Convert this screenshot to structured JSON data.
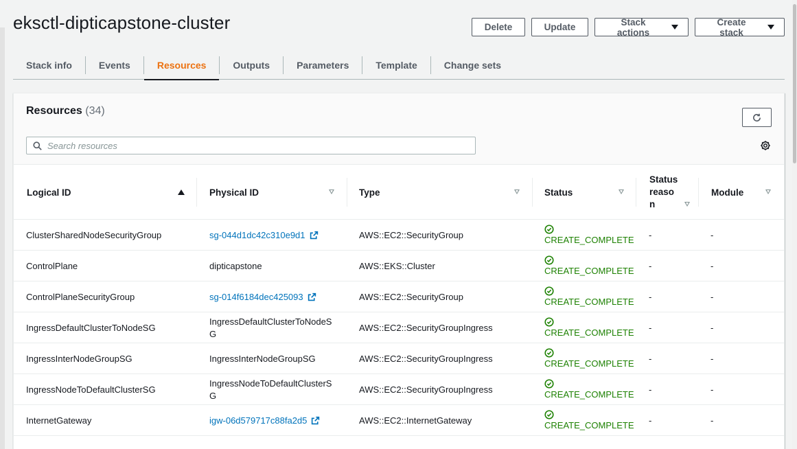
{
  "page": {
    "title": "eksctl-dipticapstone-cluster"
  },
  "header_actions": {
    "delete_label": "Delete",
    "update_label": "Update",
    "stack_actions_label": "Stack actions",
    "create_stack_label": "Create stack"
  },
  "tabs": [
    {
      "label": "Stack info"
    },
    {
      "label": "Events"
    },
    {
      "label": "Resources",
      "active": true
    },
    {
      "label": "Outputs"
    },
    {
      "label": "Parameters"
    },
    {
      "label": "Template"
    },
    {
      "label": "Change sets"
    }
  ],
  "resources": {
    "title": "Resources",
    "count": "(34)",
    "search_placeholder": "Search resources",
    "columns": {
      "logical_id": "Logical ID",
      "physical_id": "Physical ID",
      "type": "Type",
      "status": "Status",
      "status_reason": "Status reason",
      "module": "Module"
    },
    "rows": [
      {
        "logical_id": "ClusterSharedNodeSecurityGroup",
        "physical_id": "sg-044d1dc42c310e9d1",
        "physical_is_link": true,
        "type": "AWS::EC2::SecurityGroup",
        "status": "CREATE_COMPLETE",
        "status_reason": "-",
        "module": "-"
      },
      {
        "logical_id": "ControlPlane",
        "physical_id": "dipticapstone",
        "physical_is_link": false,
        "type": "AWS::EKS::Cluster",
        "status": "CREATE_COMPLETE",
        "status_reason": "-",
        "module": "-"
      },
      {
        "logical_id": "ControlPlaneSecurityGroup",
        "physical_id": "sg-014f6184dec425093",
        "physical_is_link": true,
        "type": "AWS::EC2::SecurityGroup",
        "status": "CREATE_COMPLETE",
        "status_reason": "-",
        "module": "-"
      },
      {
        "logical_id": "IngressDefaultClusterToNodeSG",
        "physical_id": "IngressDefaultClusterToNodeSG",
        "physical_is_link": false,
        "type": "AWS::EC2::SecurityGroupIngress",
        "status": "CREATE_COMPLETE",
        "status_reason": "-",
        "module": "-"
      },
      {
        "logical_id": "IngressInterNodeGroupSG",
        "physical_id": "IngressInterNodeGroupSG",
        "physical_is_link": false,
        "type": "AWS::EC2::SecurityGroupIngress",
        "status": "CREATE_COMPLETE",
        "status_reason": "-",
        "module": "-"
      },
      {
        "logical_id": "IngressNodeToDefaultClusterSG",
        "physical_id": "IngressNodeToDefaultClusterSG",
        "physical_is_link": false,
        "type": "AWS::EC2::SecurityGroupIngress",
        "status": "CREATE_COMPLETE",
        "status_reason": "-",
        "module": "-"
      },
      {
        "logical_id": "InternetGateway",
        "physical_id": "igw-06d579717c88fa2d5",
        "physical_is_link": true,
        "type": "AWS::EC2::InternetGateway",
        "status": "CREATE_COMPLETE",
        "status_reason": "-",
        "module": "-"
      }
    ]
  },
  "colors": {
    "accent_tab": "#ec7211",
    "link": "#0073bb",
    "success": "#1d8102"
  },
  "icons": {
    "search": "search-icon",
    "refresh": "refresh-icon",
    "settings": "gear-icon",
    "external_link": "external-link-icon",
    "status_ok": "check-circle-icon"
  }
}
